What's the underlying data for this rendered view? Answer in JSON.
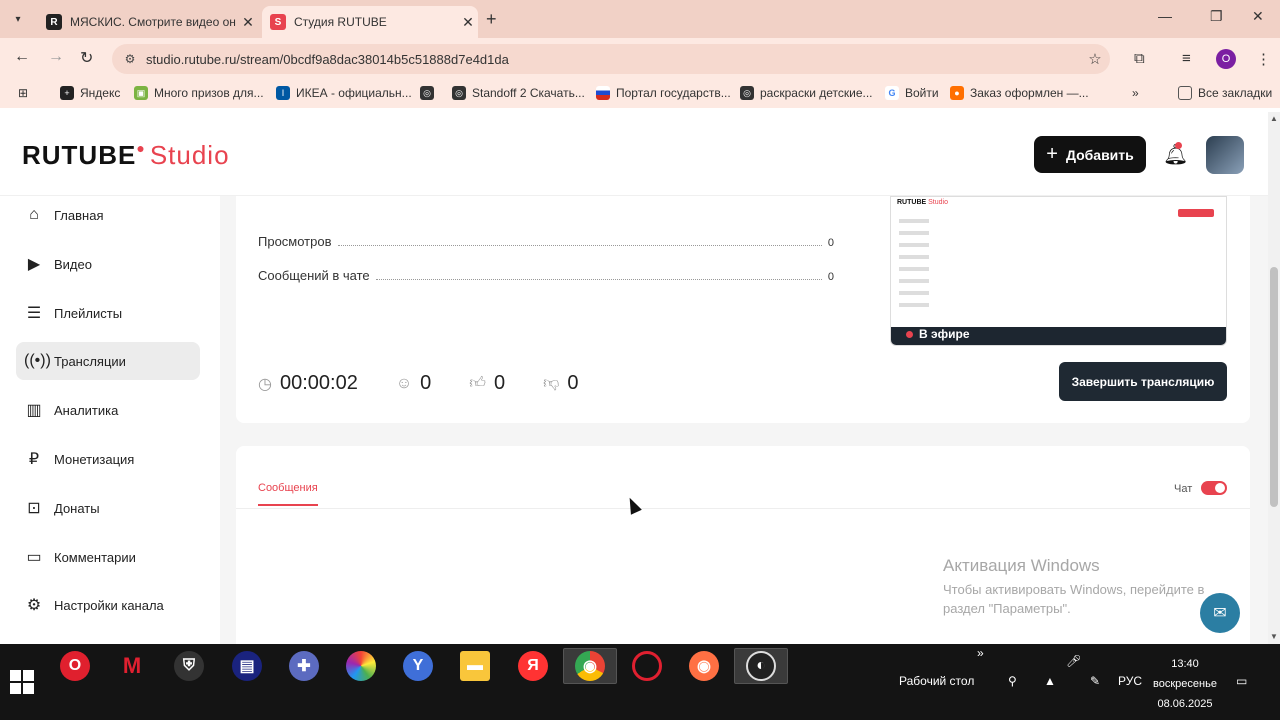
{
  "browser": {
    "tabs": [
      {
        "title": "МЯСКИС. Смотрите видео он",
        "active": false
      },
      {
        "title": "Студия RUTUBE",
        "active": true
      }
    ],
    "url": "studio.rutube.ru/stream/0bcdf9a8dac38014b5c51888d7e4d1da",
    "profile_letter": "O",
    "bookmarks": [
      "Яндекс",
      "Много призов для...",
      "ИКЕА - официальн...",
      "Standoff 2 Скачать...",
      "Портал государств...",
      "раскраски детские...",
      "Войти",
      "Заказ оформлен —...",
      "Все закладки"
    ]
  },
  "header": {
    "logo_main": "RUTUBE",
    "logo_studio": "Studio",
    "add_label": "Добавить"
  },
  "sidebar": {
    "items": [
      {
        "label": "Главная",
        "icon": "home-icon"
      },
      {
        "label": "Видео",
        "icon": "video-icon"
      },
      {
        "label": "Плейлисты",
        "icon": "playlist-icon"
      },
      {
        "label": "Трансляции",
        "icon": "broadcast-icon",
        "active": true
      },
      {
        "label": "Аналитика",
        "icon": "analytics-icon"
      },
      {
        "label": "Монетизация",
        "icon": "ruble-icon"
      },
      {
        "label": "Донаты",
        "icon": "donate-icon"
      },
      {
        "label": "Комментарии",
        "icon": "comment-icon"
      },
      {
        "label": "Настройки канала",
        "icon": "gear-icon"
      }
    ]
  },
  "stream": {
    "stats": [
      {
        "label": "Просмотров",
        "value": "0"
      },
      {
        "label": "Сообщений в чате",
        "value": "0"
      }
    ],
    "duration": "00:00:02",
    "viewers": "0",
    "likes": "0",
    "dislikes": "0",
    "on_air_label": "В эфире",
    "end_label": "Завершить трансляцию",
    "preview_logo_main": "RUTUBE",
    "preview_logo_studio": "Studio"
  },
  "chat": {
    "tab_label": "Сообщения",
    "chat_label": "Чат",
    "chat_enabled": true
  },
  "watermark": {
    "title": "Активация Windows",
    "text": "Чтобы активировать Windows, перейдите в раздел \"Параметры\"."
  },
  "taskbar": {
    "desktop_label": "Рабочий стол",
    "lang": "РУС",
    "time": "13:40",
    "day": "воскресенье",
    "date": "08.06.2025"
  }
}
